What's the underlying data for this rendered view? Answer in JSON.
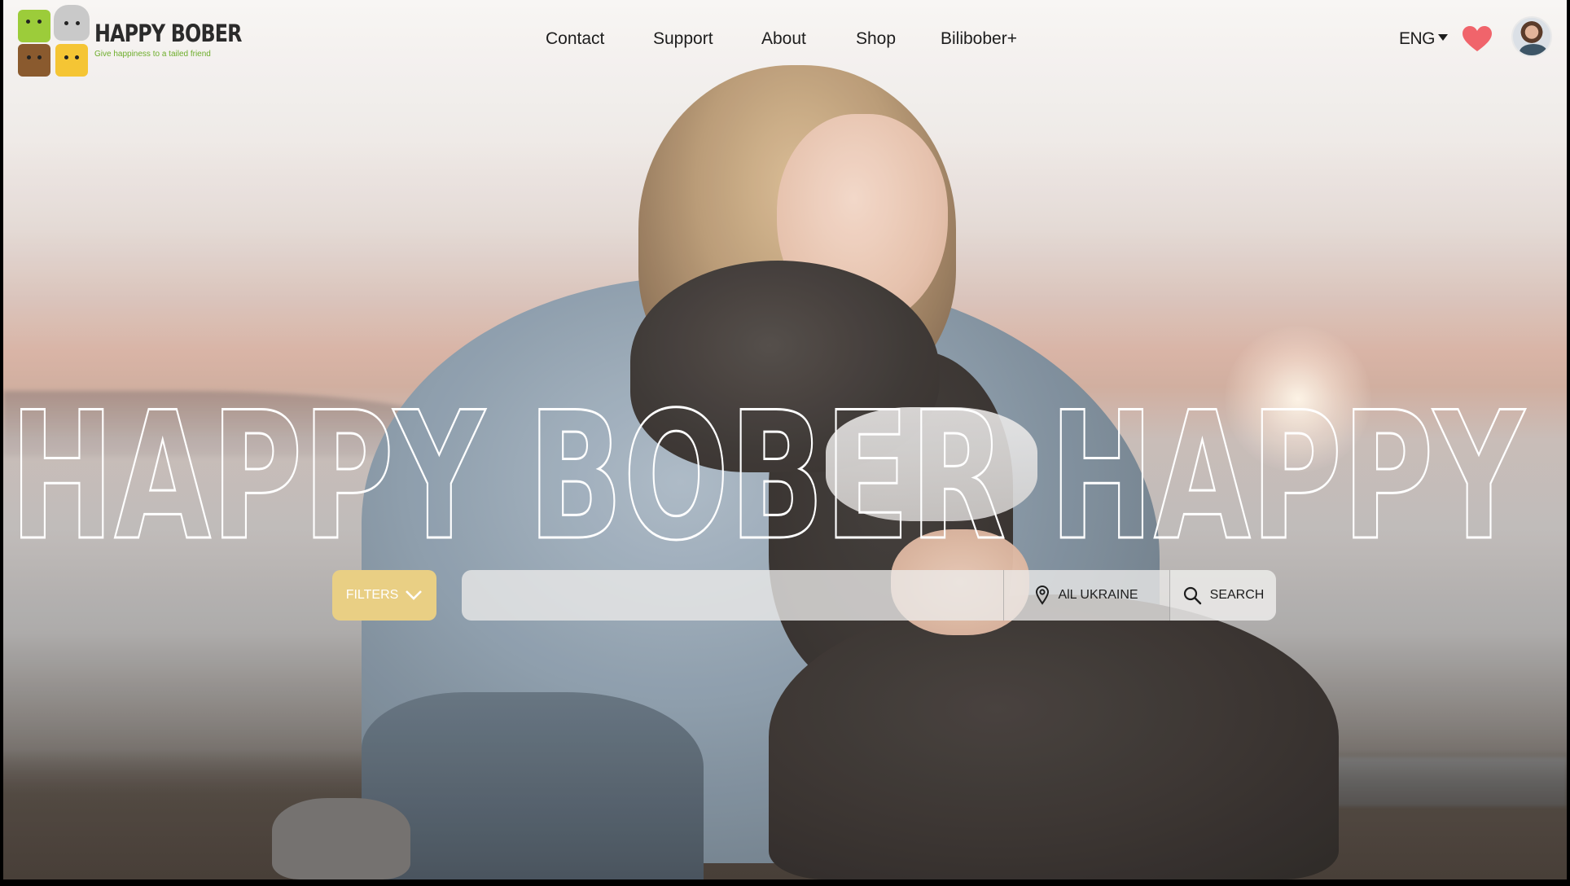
{
  "brand": {
    "name": "HAPPY BOBER",
    "tagline": "Give happiness to a tailed friend"
  },
  "nav": {
    "items": [
      {
        "label": "Contact"
      },
      {
        "label": "Support"
      },
      {
        "label": "About"
      },
      {
        "label": "Shop"
      },
      {
        "label": "Bilibober+"
      }
    ]
  },
  "header": {
    "language": "ENG",
    "favorites_icon": "heart-icon",
    "avatar_icon": "user-avatar"
  },
  "hero": {
    "headline": "HAPPY BOBER HAPPY BOBER"
  },
  "search": {
    "filters_label": "FILTERS",
    "query_value": "",
    "location_label": "AlL UKRAINE",
    "search_label": "SEARCH"
  },
  "colors": {
    "accent": "#e9cf84",
    "heart": "#f0646b",
    "tagline": "#6dad2b",
    "text": "#1d1d1d"
  }
}
